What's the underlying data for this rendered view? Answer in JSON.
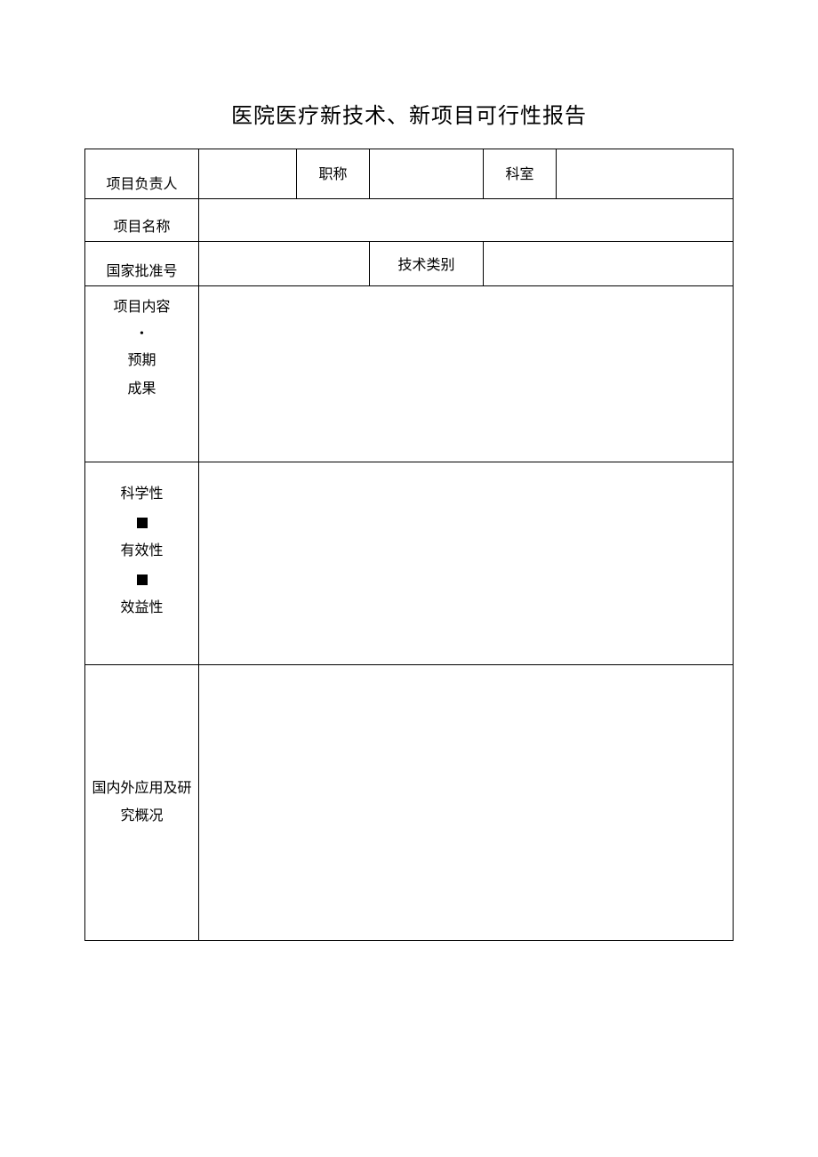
{
  "title": "医院医疗新技术、新项目可行性报告",
  "rows": {
    "r1": {
      "leader_label": "项目负责人",
      "leader_value": "",
      "title_label": "职称",
      "title_value": "",
      "dept_label": "科室",
      "dept_value": ""
    },
    "r2": {
      "name_label": "项目名称",
      "name_value": ""
    },
    "r3": {
      "approval_label": "国家批准号",
      "approval_value": "",
      "tech_label": "技术类别",
      "tech_value": ""
    },
    "r4": {
      "line1": "项目内容",
      "line2": "预期",
      "line3": "成果",
      "value": ""
    },
    "r5": {
      "line1": "科学性",
      "line2": "有效性",
      "line3": "效益性",
      "value": ""
    },
    "r6": {
      "line1": "国内外应用及研",
      "line2": "究概况",
      "value": ""
    }
  }
}
